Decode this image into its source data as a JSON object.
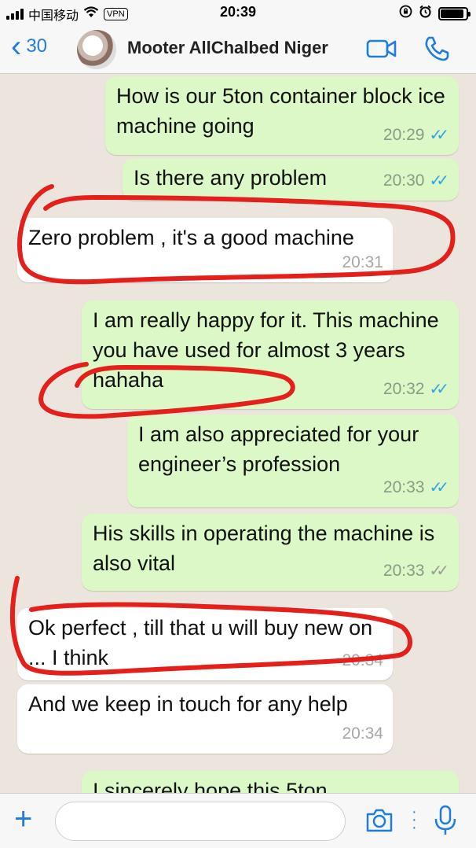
{
  "status_bar": {
    "carrier": "中国移动",
    "wifi": "wifi-icon",
    "vpn": "VPN",
    "time": "20:39",
    "battery_level": 0.9
  },
  "header": {
    "back_count": "30",
    "contact_name": "Mooter AllChalbed Niger",
    "icons": [
      "chevron-left-icon",
      "video-call-icon",
      "phone-icon"
    ]
  },
  "messages": [
    {
      "direction": "outgoing",
      "text": "How is our 5ton container block ice machine going",
      "time": "20:29",
      "status": "read"
    },
    {
      "direction": "outgoing",
      "text": "Is there any problem",
      "time": "20:30",
      "status": "read"
    },
    {
      "direction": "incoming",
      "text": "Zero problem , it's a good machine",
      "time": "20:31"
    },
    {
      "direction": "outgoing",
      "text": "I am really happy for it. This machine you have used for almost 3 years hahaha",
      "time": "20:32",
      "status": "read"
    },
    {
      "direction": "outgoing",
      "text": "I am also appreciated for your engineer’s profession",
      "time": "20:33",
      "status": "read"
    },
    {
      "direction": "outgoing",
      "text": "His skills in operating the machine is also vital",
      "time": "20:33",
      "status": "delivered"
    },
    {
      "direction": "incoming",
      "text": "Ok perfect , till that u will buy new on ... I think",
      "time": "20:34"
    },
    {
      "direction": "incoming",
      "text": "And we keep in touch for any help",
      "time": "20:34"
    },
    {
      "direction": "outgoing",
      "text": "I sincerely hope this 5ton",
      "time": "",
      "status": ""
    }
  ],
  "colors": {
    "outgoing_bubble": "#dcf8c6",
    "incoming_bubble": "#ffffff",
    "accent": "#1f7dde",
    "read_ticks": "#35a2e5",
    "annotation_marker": "#e3201b"
  },
  "input_bar": {
    "placeholder": "",
    "icons": [
      "plus-icon",
      "camera-icon",
      "microphone-icon"
    ]
  }
}
